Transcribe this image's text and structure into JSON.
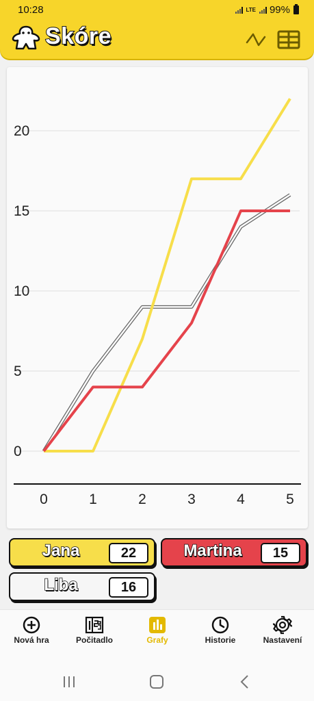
{
  "status_bar": {
    "time": "10:28",
    "network": "LTE",
    "battery": "99%"
  },
  "header": {
    "title": "Skóre",
    "icons": [
      "meeple-logo-icon",
      "line-chart-icon",
      "table-icon"
    ]
  },
  "chart_data": {
    "type": "line",
    "x": [
      0,
      1,
      2,
      3,
      4,
      5
    ],
    "xlim": [
      0,
      5
    ],
    "ylim": [
      0,
      22
    ],
    "yticks": [
      0,
      5,
      10,
      15,
      20
    ],
    "grid": true,
    "series": [
      {
        "name": "Jana",
        "color": "#f7de4a",
        "values": [
          0,
          0,
          7,
          17,
          17,
          22
        ]
      },
      {
        "name": "Martina",
        "color": "#e5434b",
        "values": [
          0,
          4,
          4,
          8,
          15,
          15
        ]
      },
      {
        "name": "Liba",
        "color": "#f6f6f6",
        "values": [
          0,
          5,
          9,
          9,
          14,
          16
        ]
      }
    ]
  },
  "players": [
    {
      "name": "Jana",
      "score": "22",
      "color": "#f7de4a"
    },
    {
      "name": "Martina",
      "score": "15",
      "color": "#e5434b"
    },
    {
      "name": "Liba",
      "score": "16",
      "color": "#f6f6f6"
    }
  ],
  "nav": {
    "items": [
      {
        "label": "Nová hra",
        "icon": "plus-circle-icon"
      },
      {
        "label": "Počitadlo",
        "icon": "counter-icon"
      },
      {
        "label": "Grafy",
        "icon": "bar-chart-icon",
        "active": true
      },
      {
        "label": "Historie",
        "icon": "clock-icon"
      },
      {
        "label": "Nastavení",
        "icon": "gear-icon"
      }
    ],
    "accent": "#e3b900"
  },
  "system_nav": [
    "recents-icon",
    "home-icon",
    "back-icon"
  ]
}
